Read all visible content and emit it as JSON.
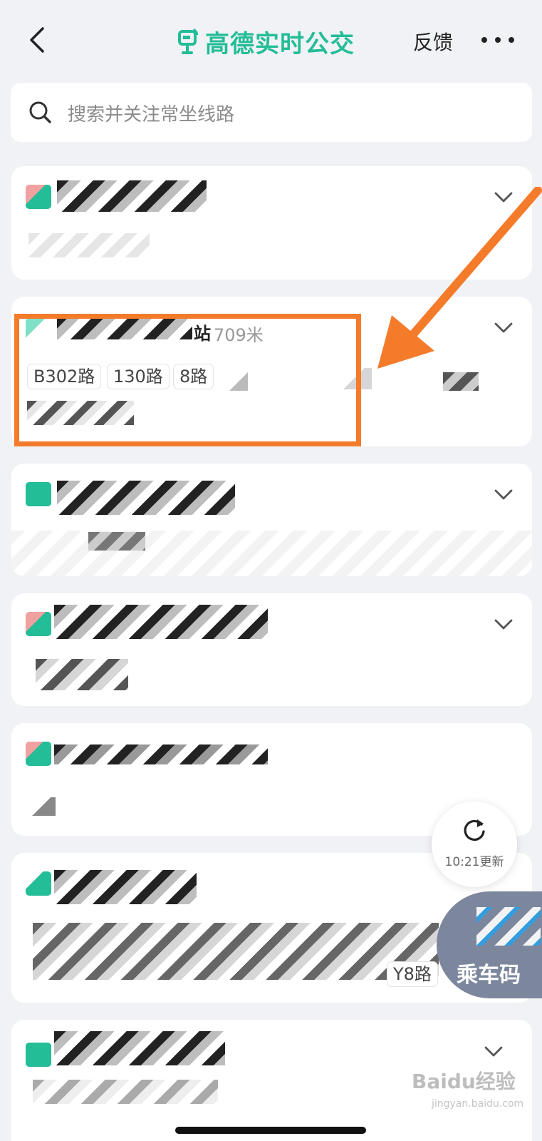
{
  "header": {
    "app_title": "高德实时公交",
    "feedback_label": "反馈"
  },
  "search": {
    "placeholder": "搜索并关注常坐线路"
  },
  "highlighted_station": {
    "name_visible_char": "站",
    "distance": "709米",
    "routes": [
      "B302路",
      "130路",
      "8路"
    ]
  },
  "refresh": {
    "label": "10:21更新"
  },
  "ride_button": {
    "label": "乘车码"
  },
  "partial_route_chip": "Y8路",
  "watermark": {
    "brand": "Baidu经验",
    "url": "jingyan.baidu.com"
  },
  "colors": {
    "brand_green": "#23bd97",
    "annotation_orange": "#f47b2a",
    "background": "#f1f2f6",
    "card": "#ffffff",
    "ride_button": "#7c879e"
  }
}
